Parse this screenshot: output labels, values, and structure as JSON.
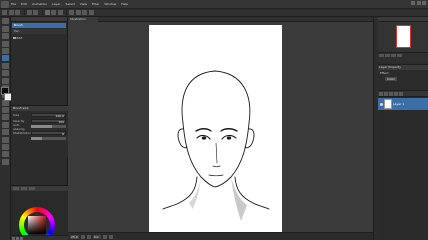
{
  "menu": [
    "File",
    "Edit",
    "View",
    "Layer",
    "Select",
    "Filter",
    "Window",
    "Help",
    "Animation",
    "Story"
  ],
  "tool_property": {
    "title": "Tool property",
    "entry": "Brush",
    "sub_entry": "Pen",
    "checkbox_label": "Edit"
  },
  "brush_props": {
    "title": "Brush size",
    "size_label": "Size",
    "size_value": "100.0",
    "opacity_label": "Opacity",
    "opacity_value": "100",
    "anti_label": "Anti-aliasing",
    "stab_label": "Stabilization",
    "stab_value": "6",
    "anti_level_fraction": 0.6,
    "stab_level_fraction": 0.3
  },
  "status": {
    "zoom": "25.0",
    "angle": "0.0"
  },
  "layer_property": {
    "title": "Layer Property",
    "effect_label": "Effect",
    "color_btn": "Color"
  },
  "layers": [
    {
      "name": "Layer 1",
      "selected": true
    }
  ],
  "colors": {
    "fg": "#0d0d0d",
    "bg": "#f2f2f2",
    "accent": "#3d6ea6",
    "wheel_sat": "#c01010"
  },
  "canvas_tab": "Illustration"
}
